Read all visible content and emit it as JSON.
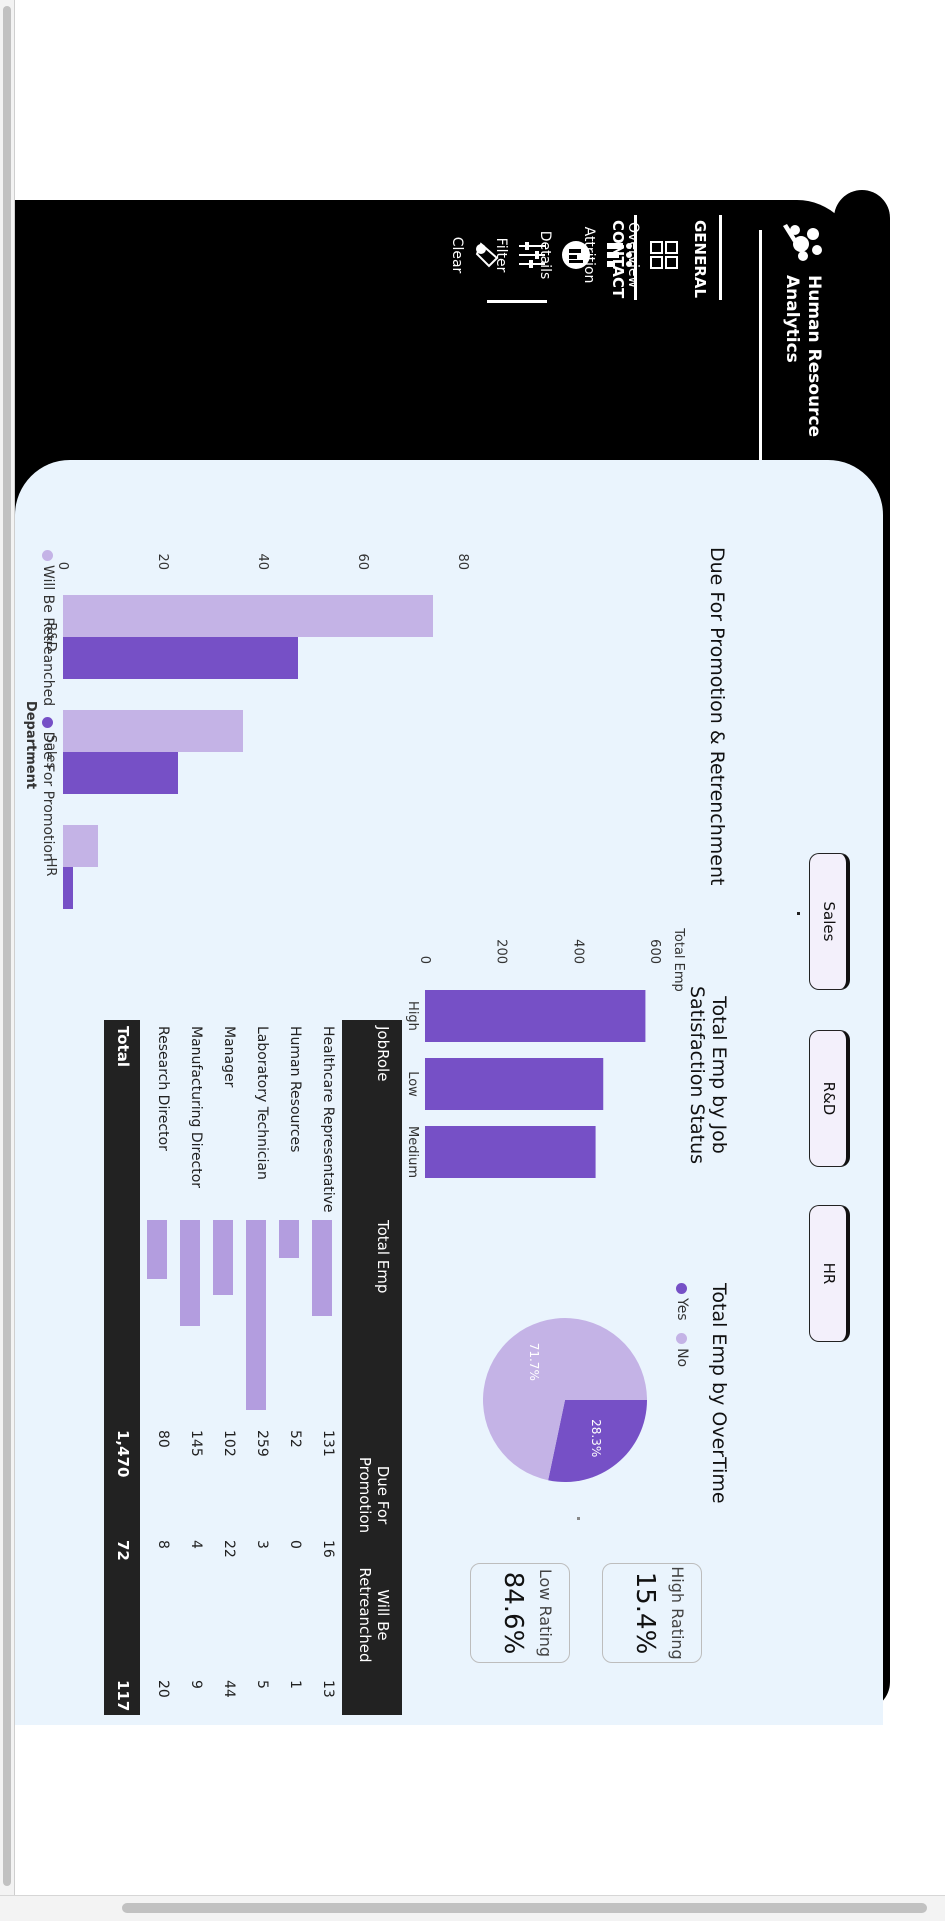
{
  "app": {
    "title": "Human Resource Analytics",
    "brand_name": "Human Resource Analytics",
    "accent_color": "#7650c6",
    "light_color": "#c4b3e6"
  },
  "sidebar": {
    "sections": [
      {
        "title": "GENERAL",
        "items": [
          {
            "label": "Overview",
            "icon": "grid-icon"
          },
          {
            "label": "Attrition",
            "icon": "people-chart-icon"
          },
          {
            "label": "Details",
            "icon": "details-icon",
            "active": true
          },
          {
            "label": "Filter",
            "icon": "sliders-icon"
          },
          {
            "label": "Clear",
            "icon": "eraser-icon"
          }
        ]
      },
      {
        "title": "CONTACT",
        "items": [
          {
            "label": "Mail",
            "icon": "mail-icon"
          },
          {
            "label": "Chat",
            "icon": "chat-icon"
          }
        ]
      }
    ]
  },
  "slicer": {
    "buttons": [
      "Sales",
      "R&D",
      "HR"
    ]
  },
  "kpis": [
    {
      "label": "High Rating",
      "value": "15.4%"
    },
    {
      "label": "Low Rating",
      "value": "84.6%"
    }
  ],
  "charts": {
    "promotion": {
      "title": "Due For Promotion & Retrenchment",
      "xlabel": "Department",
      "legend": [
        "Will Be Retreanched",
        "Due For Promotion"
      ]
    },
    "satisfaction": {
      "title": "Total Emp by Job Satisfaction Status",
      "ylabel": "Total Emp"
    },
    "overtime": {
      "title": "Total Emp by OverTime",
      "legend": [
        "Yes",
        "No"
      ]
    }
  },
  "chart_data": [
    {
      "type": "bar",
      "title": "Due For Promotion & Retrenchment",
      "xlabel": "Department",
      "categories": [
        "R&D",
        "Sales",
        "HR"
      ],
      "series": [
        {
          "name": "Will Be Retreanched",
          "values": [
            74,
            36,
            7
          ]
        },
        {
          "name": "Due For Promotion",
          "values": [
            47,
            23,
            2
          ]
        }
      ],
      "ylim": [
        0,
        80
      ],
      "yticks": [
        0,
        20,
        40,
        60,
        80
      ],
      "legend": "bottom"
    },
    {
      "type": "bar",
      "title": "Total Emp by Job Satisfaction Status",
      "ylabel": "Total Emp",
      "categories": [
        "High",
        "Low",
        "Medium"
      ],
      "values": [
        575,
        465,
        445
      ],
      "ylim": [
        0,
        600
      ],
      "yticks": [
        0,
        200,
        400,
        600
      ]
    },
    {
      "type": "pie",
      "title": "Total Emp by OverTime",
      "labels": [
        "Yes",
        "No"
      ],
      "values": [
        28.3,
        71.7
      ],
      "value_labels": [
        "28.3%",
        "71.7%"
      ],
      "legend": "top"
    }
  ],
  "table": {
    "columns": [
      "JobRole",
      "Total Emp",
      "Due For Promotion",
      "Will Be Retreanched"
    ],
    "rows": [
      {
        "role": "Healthcare Representative",
        "total": "131",
        "promo": "16",
        "retr": "13",
        "n": 131
      },
      {
        "role": "Human Resources",
        "total": "52",
        "promo": "0",
        "retr": "1",
        "n": 52
      },
      {
        "role": "Laboratory Technician",
        "total": "259",
        "promo": "3",
        "retr": "5",
        "n": 259
      },
      {
        "role": "Manager",
        "total": "102",
        "promo": "22",
        "retr": "44",
        "n": 102
      },
      {
        "role": "Manufacturing Director",
        "total": "145",
        "promo": "4",
        "retr": "9",
        "n": 145
      },
      {
        "role": "Research Director",
        "total": "80",
        "promo": "8",
        "retr": "20",
        "n": 80
      }
    ],
    "total": {
      "label": "Total",
      "total": "1,470",
      "promo": "72",
      "retr": "117"
    }
  }
}
